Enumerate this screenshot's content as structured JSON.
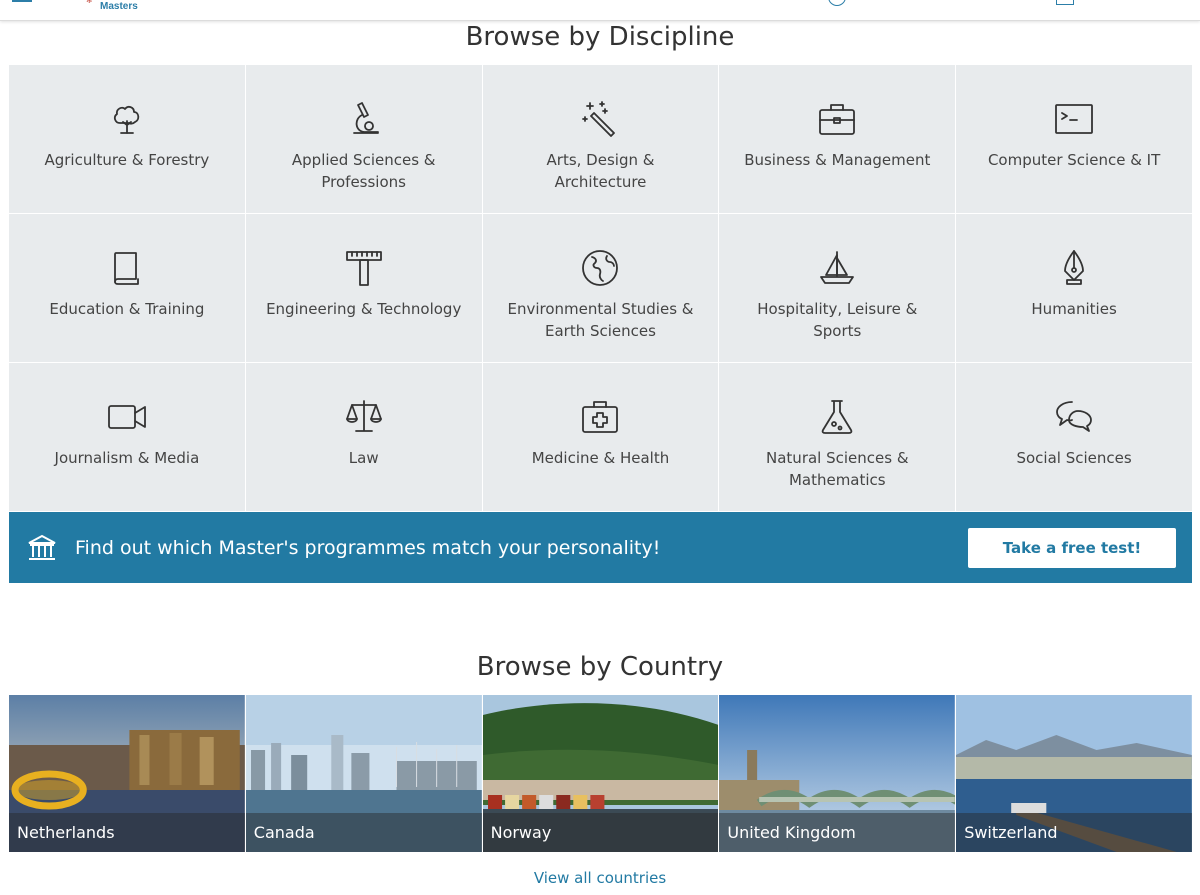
{
  "header": {
    "logo_text": "Masters"
  },
  "discipline": {
    "title": "Browse by Discipline",
    "items": [
      {
        "label": "Agriculture & Forestry",
        "icon": "tree-icon"
      },
      {
        "label": "Applied Sciences & Professions",
        "icon": "microscope-icon"
      },
      {
        "label": "Arts, Design & Architecture",
        "icon": "magic-wand-icon"
      },
      {
        "label": "Business & Management",
        "icon": "briefcase-icon"
      },
      {
        "label": "Computer Science & IT",
        "icon": "terminal-icon"
      },
      {
        "label": "Education & Training",
        "icon": "book-icon"
      },
      {
        "label": "Engineering & Technology",
        "icon": "t-square-icon"
      },
      {
        "label": "Environmental Studies & Earth Sciences",
        "icon": "globe-icon"
      },
      {
        "label": "Hospitality, Leisure & Sports",
        "icon": "sailboat-icon"
      },
      {
        "label": "Humanities",
        "icon": "fountain-pen-icon"
      },
      {
        "label": "Journalism & Media",
        "icon": "video-camera-icon"
      },
      {
        "label": "Law",
        "icon": "scales-icon"
      },
      {
        "label": "Medicine & Health",
        "icon": "first-aid-kit-icon"
      },
      {
        "label": "Natural Sciences & Mathematics",
        "icon": "flask-icon"
      },
      {
        "label": "Social Sciences",
        "icon": "speech-bubbles-icon"
      }
    ]
  },
  "banner": {
    "text": "Find out which Master's programmes match your personality!",
    "button_label": "Take a free test!",
    "icon": "institution-icon",
    "color": "#227aa3"
  },
  "country": {
    "title": "Browse by Country",
    "items": [
      {
        "label": "Netherlands"
      },
      {
        "label": "Canada"
      },
      {
        "label": "Norway"
      },
      {
        "label": "United Kingdom"
      },
      {
        "label": "Switzerland"
      }
    ],
    "view_all": "View all countries"
  }
}
